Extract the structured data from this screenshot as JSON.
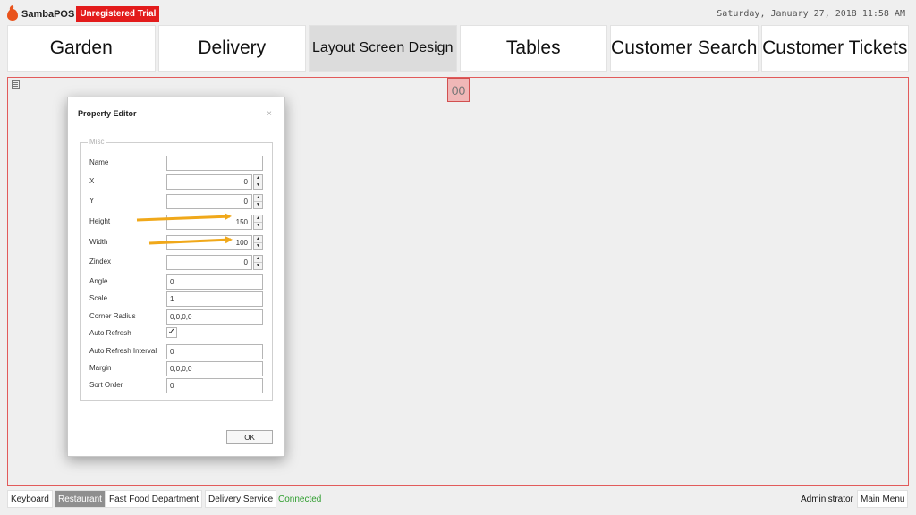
{
  "app": {
    "name": "SambaPOS",
    "trial_badge": "Unregistered Trial",
    "datetime": "Saturday, January 27, 2018 11:58 AM"
  },
  "tabs": [
    {
      "label": "Garden"
    },
    {
      "label": "Delivery"
    },
    {
      "label": "Layout Screen Design",
      "active": true
    },
    {
      "label": "Tables"
    },
    {
      "label": "Customer Search"
    },
    {
      "label": "Customer Tickets"
    }
  ],
  "canvas": {
    "widget_label": "00"
  },
  "dialog": {
    "title": "Property Editor",
    "close_glyph": "×",
    "group_label": "Misc",
    "fields": {
      "name": {
        "label": "Name",
        "value": ""
      },
      "x": {
        "label": "X",
        "value": "0"
      },
      "y": {
        "label": "Y",
        "value": "0"
      },
      "height": {
        "label": "Height",
        "value": "150"
      },
      "width": {
        "label": "Width",
        "value": "100"
      },
      "zindex": {
        "label": "Zindex",
        "value": "0"
      },
      "angle": {
        "label": "Angle",
        "value": "0"
      },
      "scale": {
        "label": "Scale",
        "value": "1"
      },
      "corner_radius": {
        "label": "Corner Radius",
        "value": "0,0,0,0"
      },
      "auto_refresh": {
        "label": "Auto Refresh",
        "checked": true,
        "check_glyph": "✓"
      },
      "auto_refresh_interval": {
        "label": "Auto Refresh Interval",
        "value": "0"
      },
      "margin": {
        "label": "Margin",
        "value": "0,0,0,0"
      },
      "sort_order": {
        "label": "Sort Order",
        "value": "0"
      }
    },
    "spin_up": "▲",
    "spin_down": "▼",
    "ok_label": "OK"
  },
  "statusbar": {
    "keyboard": "Keyboard",
    "restaurant": "Restaurant",
    "fast_food": "Fast Food Department",
    "delivery_service": "Delivery Service",
    "connection": "Connected",
    "user": "Administrator",
    "main_menu": "Main Menu"
  },
  "colors": {
    "accent_red": "#e31b1b",
    "arrow": "#f0a81a",
    "connected": "#2f9e2f"
  }
}
